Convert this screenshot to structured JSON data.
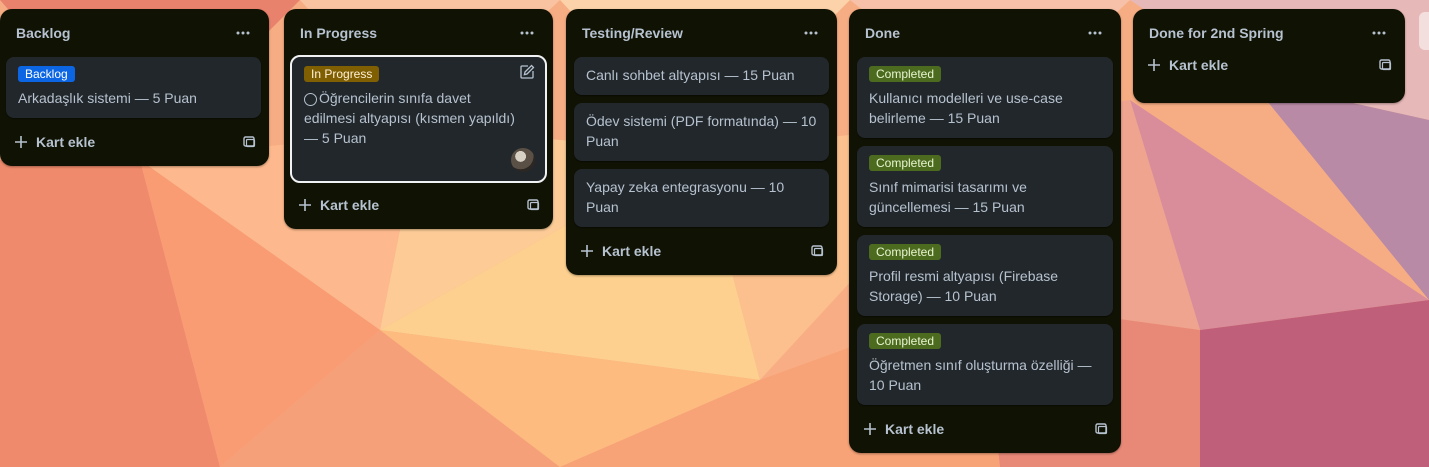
{
  "colors": {
    "list_bg": "#101204",
    "card_bg": "#22272b",
    "text": "#b6c2cf",
    "label_blue": "#0c66e4",
    "label_yellow": "#7f5f01",
    "label_green": "#4c6b1f"
  },
  "icons": {
    "more": "ellipsis-icon",
    "add": "plus-icon",
    "template": "card-template-icon",
    "edit": "pencil-icon",
    "checkbox": "circle-check-icon"
  },
  "add_card_label": "Kart ekle",
  "lists": [
    {
      "title": "Backlog",
      "cards": [
        {
          "label": "Backlog",
          "text": "Arkadaşlık sistemi — 5 Puan"
        }
      ]
    },
    {
      "title": "In Progress",
      "cards": [
        {
          "label": "In Progress",
          "text": "Öğrencilerin sınıfa davet edilmesi altyapısı (kısmen yapıldı) — 5 Puan"
        }
      ]
    },
    {
      "title": "Testing/Review",
      "cards": [
        {
          "text": "Canlı sohbet altyapısı — 15 Puan"
        },
        {
          "text": "Ödev sistemi (PDF formatında) — 10 Puan"
        },
        {
          "text": "Yapay zeka entegrasyonu — 10 Puan"
        }
      ]
    },
    {
      "title": "Done",
      "cards": [
        {
          "label": "Completed",
          "text": "Kullanıcı modelleri ve use-case belirleme — 15 Puan"
        },
        {
          "label": "Completed",
          "text": "Sınıf mimarisi tasarımı ve güncellemesi — 15 Puan"
        },
        {
          "label": "Completed",
          "text": "Profil resmi altyapısı (Firebase Storage) — 10 Puan"
        },
        {
          "label": "Completed",
          "text": "Öğretmen sınıf oluşturma özelliği — 10 Puan"
        }
      ]
    },
    {
      "title": "Done for 2nd Spring",
      "cards": []
    }
  ]
}
